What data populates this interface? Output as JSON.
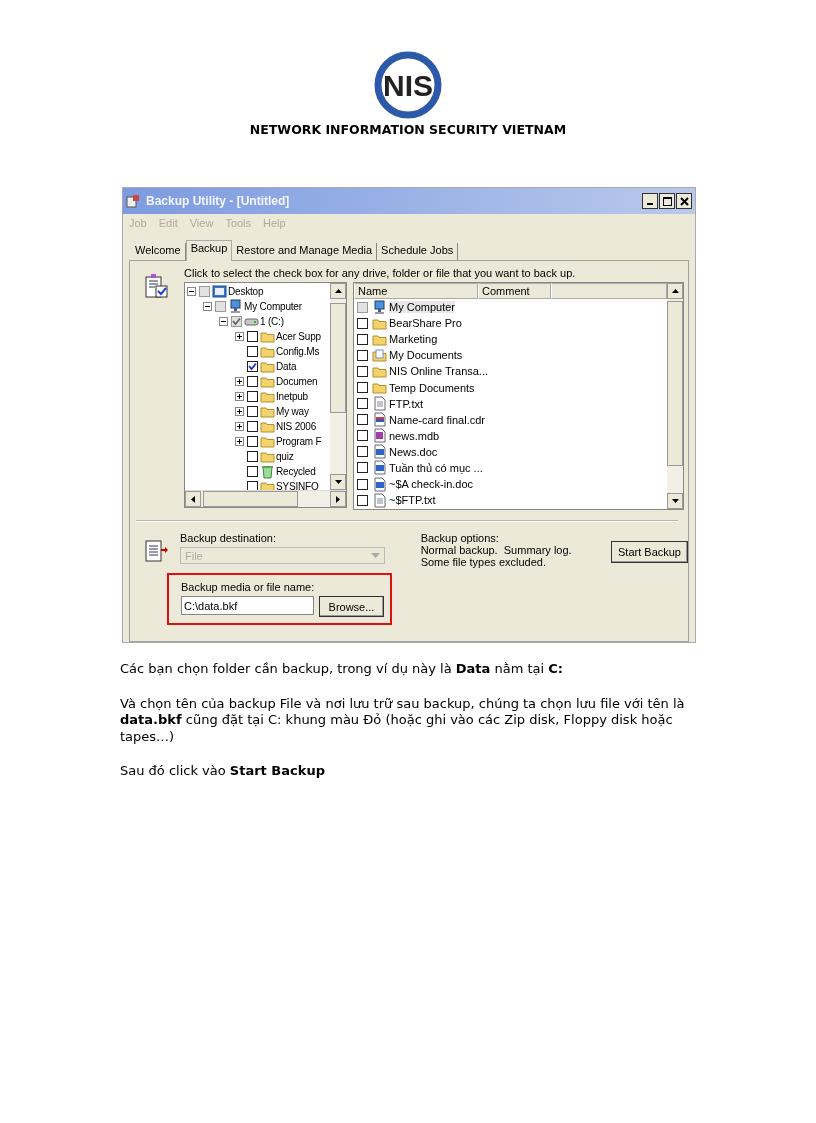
{
  "logo": {
    "text": "NIS"
  },
  "header": "NETWORK INFORMATION SECURITY VIETNAM",
  "window": {
    "title": "Backup Utility - [Untitled]",
    "menu": [
      {
        "label": "Job",
        "disabled": true
      },
      {
        "label": "Edit",
        "disabled": true
      },
      {
        "label": "View",
        "disabled": true
      },
      {
        "label": "Tools",
        "disabled": true
      },
      {
        "label": "Help",
        "disabled": true
      }
    ],
    "tabs": [
      {
        "label": "Welcome",
        "selected": false
      },
      {
        "label": "Backup",
        "selected": true
      },
      {
        "label": "Restore and Manage Media",
        "selected": false
      },
      {
        "label": "Schedule Jobs",
        "selected": false
      }
    ],
    "instruction": "Click to select the check box for any drive, folder or file that you want to back up.",
    "tree": [
      {
        "label": "Desktop",
        "kind": "desktop",
        "expandable": true,
        "expanded": true,
        "checked": false,
        "greyed": true,
        "children": [
          {
            "label": "My Computer",
            "kind": "computer",
            "expandable": true,
            "expanded": true,
            "checked": false,
            "greyed": true,
            "children": [
              {
                "label": "1 (C:)",
                "kind": "drive",
                "expandable": true,
                "expanded": true,
                "checked": true,
                "greyed": true,
                "children": [
                  {
                    "label": "Acer Supp",
                    "kind": "folder",
                    "expandable": true,
                    "expanded": false,
                    "checked": false,
                    "greyed": false
                  },
                  {
                    "label": "Config.Ms",
                    "kind": "folder",
                    "expandable": false,
                    "checked": false,
                    "greyed": false
                  },
                  {
                    "label": "Data",
                    "kind": "folder",
                    "expandable": false,
                    "checked": true,
                    "greyed": false
                  },
                  {
                    "label": "Documen",
                    "kind": "folder",
                    "expandable": true,
                    "expanded": false,
                    "checked": false,
                    "greyed": false
                  },
                  {
                    "label": "Inetpub",
                    "kind": "folder",
                    "expandable": true,
                    "expanded": false,
                    "checked": false,
                    "greyed": false
                  },
                  {
                    "label": "My way",
                    "kind": "folder",
                    "expandable": true,
                    "expanded": false,
                    "checked": false,
                    "greyed": false
                  },
                  {
                    "label": "NIS 2006",
                    "kind": "folder",
                    "expandable": true,
                    "expanded": false,
                    "checked": false,
                    "greyed": false
                  },
                  {
                    "label": "Program F",
                    "kind": "folder",
                    "expandable": true,
                    "expanded": false,
                    "checked": false,
                    "greyed": false
                  },
                  {
                    "label": "quiz",
                    "kind": "folder",
                    "expandable": false,
                    "checked": false,
                    "greyed": false
                  },
                  {
                    "label": "Recycled",
                    "kind": "recycle",
                    "expandable": false,
                    "checked": false,
                    "greyed": false
                  },
                  {
                    "label": "SYSINFO",
                    "kind": "folder",
                    "expandable": false,
                    "checked": false,
                    "greyed": false
                  }
                ]
              }
            ]
          }
        ]
      }
    ],
    "list": {
      "columns": [
        "Name",
        "Comment"
      ],
      "rows": [
        {
          "name": "My Computer",
          "kind": "computer",
          "checked": false,
          "greyed": true
        },
        {
          "name": "BearShare Pro",
          "kind": "folder",
          "checked": false,
          "greyed": false
        },
        {
          "name": "Marketing",
          "kind": "folder",
          "checked": false,
          "greyed": false
        },
        {
          "name": "My Documents",
          "kind": "mydocs",
          "checked": false,
          "greyed": false
        },
        {
          "name": "NIS Online Transa...",
          "kind": "folder",
          "checked": false,
          "greyed": false
        },
        {
          "name": "Temp Documents",
          "kind": "folder",
          "checked": false,
          "greyed": false
        },
        {
          "name": "FTP.txt",
          "kind": "txt",
          "checked": false,
          "greyed": false
        },
        {
          "name": "Name-card final.cdr",
          "kind": "cdr",
          "checked": false,
          "greyed": false
        },
        {
          "name": "news.mdb",
          "kind": "mdb",
          "checked": false,
          "greyed": false
        },
        {
          "name": "News.doc",
          "kind": "doc",
          "checked": false,
          "greyed": false
        },
        {
          "name": "Tuần thủ có mục ...",
          "kind": "doc",
          "checked": false,
          "greyed": false
        },
        {
          "name": "~$A check-in.doc",
          "kind": "doc",
          "checked": false,
          "greyed": false
        },
        {
          "name": "~$FTP.txt",
          "kind": "txt",
          "checked": false,
          "greyed": false
        }
      ]
    },
    "destination": {
      "label": "Backup destination:",
      "value": "File",
      "disabled": true
    },
    "media": {
      "label": "Backup media or file name:",
      "value": "C:\\data.bkf",
      "button": "Browse...",
      "highlighted": true
    },
    "options": {
      "label": "Backup options:",
      "lines": [
        "Normal backup.  Summary log.",
        "Some file types excluded."
      ]
    },
    "start_button": "Start Backup"
  },
  "paragraphs": [
    "Các bạn chọn folder cần backup, trong ví dụ này là **Data** nằm tại **C:**",
    "Và chọn tên của backup File và nơi lưu trữ sau backup, chúng ta chọn lưu file với tên là **data.bkf** cũng đặt tại C: khung màu Đỏ (hoặc ghi vào các Zip disk, Floppy disk hoặc tapes…)",
    "Sau đó click vào **Start Backup**"
  ]
}
